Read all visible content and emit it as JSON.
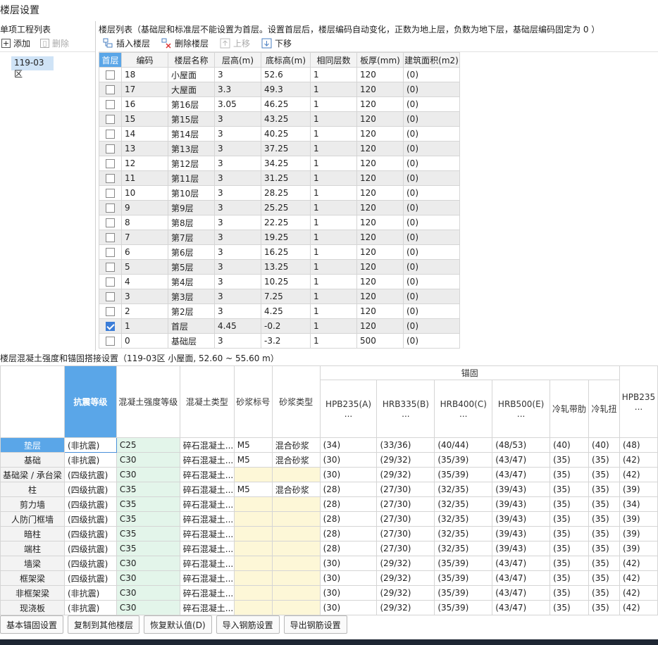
{
  "window": {
    "title": "楼层设置"
  },
  "left": {
    "header": "单项工程列表",
    "add": "添加",
    "delete": "删除",
    "items": [
      "119-03区"
    ]
  },
  "right": {
    "header": "楼层列表（基础层和标准层不能设置为首层。设置首层后，楼层编码自动变化，正数为地上层，负数为地下层，基础层编码固定为 0 ）",
    "insert": "插入楼层",
    "delete": "删除楼层",
    "up": "上移",
    "down": "下移",
    "columns": [
      "首层",
      "编码",
      "楼层名称",
      "层高(m)",
      "底标高(m)",
      "相同层数",
      "板厚(mm)",
      "建筑面积(m2)"
    ],
    "rows": [
      {
        "checked": false,
        "code": "18",
        "name": "小屋面",
        "height": "3",
        "elev": "52.6",
        "same": "1",
        "thick": "120",
        "area": "(0)"
      },
      {
        "checked": false,
        "code": "17",
        "name": "大屋面",
        "height": "3.3",
        "elev": "49.3",
        "same": "1",
        "thick": "120",
        "area": "(0)"
      },
      {
        "checked": false,
        "code": "16",
        "name": "第16层",
        "height": "3.05",
        "elev": "46.25",
        "same": "1",
        "thick": "120",
        "area": "(0)"
      },
      {
        "checked": false,
        "code": "15",
        "name": "第15层",
        "height": "3",
        "elev": "43.25",
        "same": "1",
        "thick": "120",
        "area": "(0)"
      },
      {
        "checked": false,
        "code": "14",
        "name": "第14层",
        "height": "3",
        "elev": "40.25",
        "same": "1",
        "thick": "120",
        "area": "(0)"
      },
      {
        "checked": false,
        "code": "13",
        "name": "第13层",
        "height": "3",
        "elev": "37.25",
        "same": "1",
        "thick": "120",
        "area": "(0)"
      },
      {
        "checked": false,
        "code": "12",
        "name": "第12层",
        "height": "3",
        "elev": "34.25",
        "same": "1",
        "thick": "120",
        "area": "(0)"
      },
      {
        "checked": false,
        "code": "11",
        "name": "第11层",
        "height": "3",
        "elev": "31.25",
        "same": "1",
        "thick": "120",
        "area": "(0)"
      },
      {
        "checked": false,
        "code": "10",
        "name": "第10层",
        "height": "3",
        "elev": "28.25",
        "same": "1",
        "thick": "120",
        "area": "(0)"
      },
      {
        "checked": false,
        "code": "9",
        "name": "第9层",
        "height": "3",
        "elev": "25.25",
        "same": "1",
        "thick": "120",
        "area": "(0)"
      },
      {
        "checked": false,
        "code": "8",
        "name": "第8层",
        "height": "3",
        "elev": "22.25",
        "same": "1",
        "thick": "120",
        "area": "(0)"
      },
      {
        "checked": false,
        "code": "7",
        "name": "第7层",
        "height": "3",
        "elev": "19.25",
        "same": "1",
        "thick": "120",
        "area": "(0)"
      },
      {
        "checked": false,
        "code": "6",
        "name": "第6层",
        "height": "3",
        "elev": "16.25",
        "same": "1",
        "thick": "120",
        "area": "(0)"
      },
      {
        "checked": false,
        "code": "5",
        "name": "第5层",
        "height": "3",
        "elev": "13.25",
        "same": "1",
        "thick": "120",
        "area": "(0)"
      },
      {
        "checked": false,
        "code": "4",
        "name": "第4层",
        "height": "3",
        "elev": "10.25",
        "same": "1",
        "thick": "120",
        "area": "(0)"
      },
      {
        "checked": false,
        "code": "3",
        "name": "第3层",
        "height": "3",
        "elev": "7.25",
        "same": "1",
        "thick": "120",
        "area": "(0)"
      },
      {
        "checked": false,
        "code": "2",
        "name": "第2层",
        "height": "3",
        "elev": "4.25",
        "same": "1",
        "thick": "120",
        "area": "(0)"
      },
      {
        "checked": true,
        "code": "1",
        "name": "首层",
        "height": "4.45",
        "elev": "-0.2",
        "same": "1",
        "thick": "120",
        "area": "(0)"
      },
      {
        "checked": false,
        "code": "0",
        "name": "基础层",
        "height": "3",
        "elev": "-3.2",
        "same": "1",
        "thick": "500",
        "area": "(0)"
      }
    ]
  },
  "anchor": {
    "title": "楼层混凝土强度和锚固搭接设置（119-03区 小屋面, 52.60 ~ 55.60 m）",
    "group_label": "锚固",
    "columns": [
      "抗震等级",
      "混凝土强度等级",
      "混凝土类型",
      "砂浆标号",
      "砂浆类型",
      "HPB235(A)\n...",
      "HRB335(B)\n...",
      "HRB400(C)\n...",
      "HRB500(E)\n...",
      "冷轧带肋",
      "冷轧扭",
      "HPB235\n..."
    ],
    "rows": [
      {
        "name": "垫层",
        "seis": "(非抗震)",
        "grade": "C25",
        "type": "碎石混凝土...",
        "mark": "M5",
        "mtype": "混合砂浆",
        "a": "(34)",
        "b": "(33/36)",
        "c": "(40/44)",
        "e": "(48/53)",
        "lr": "(40)",
        "lz": "(40)",
        "h2": "(48)"
      },
      {
        "name": "基础",
        "seis": "(非抗震)",
        "grade": "C30",
        "type": "碎石混凝土...",
        "mark": "M5",
        "mtype": "混合砂浆",
        "a": "(30)",
        "b": "(29/32)",
        "c": "(35/39)",
        "e": "(43/47)",
        "lr": "(35)",
        "lz": "(35)",
        "h2": "(42)"
      },
      {
        "name": "基础梁 / 承台梁",
        "seis": "(四级抗震)",
        "grade": "C30",
        "type": "碎石混凝土...",
        "mark": "",
        "mtype": "",
        "a": "(30)",
        "b": "(29/32)",
        "c": "(35/39)",
        "e": "(43/47)",
        "lr": "(35)",
        "lz": "(35)",
        "h2": "(42)"
      },
      {
        "name": "柱",
        "seis": "(四级抗震)",
        "grade": "C35",
        "type": "碎石混凝土...",
        "mark": "M5",
        "mtype": "混合砂浆",
        "a": "(28)",
        "b": "(27/30)",
        "c": "(32/35)",
        "e": "(39/43)",
        "lr": "(35)",
        "lz": "(35)",
        "h2": "(39)"
      },
      {
        "name": "剪力墙",
        "seis": "(四级抗震)",
        "grade": "C35",
        "type": "碎石混凝土...",
        "mark": "",
        "mtype": "",
        "a": "(28)",
        "b": "(27/30)",
        "c": "(32/35)",
        "e": "(39/43)",
        "lr": "(35)",
        "lz": "(35)",
        "h2": "(34)"
      },
      {
        "name": "人防门框墙",
        "seis": "(四级抗震)",
        "grade": "C35",
        "type": "碎石混凝土...",
        "mark": "",
        "mtype": "",
        "a": "(28)",
        "b": "(27/30)",
        "c": "(32/35)",
        "e": "(39/43)",
        "lr": "(35)",
        "lz": "(35)",
        "h2": "(39)"
      },
      {
        "name": "暗柱",
        "seis": "(四级抗震)",
        "grade": "C35",
        "type": "碎石混凝土...",
        "mark": "",
        "mtype": "",
        "a": "(28)",
        "b": "(27/30)",
        "c": "(32/35)",
        "e": "(39/43)",
        "lr": "(35)",
        "lz": "(35)",
        "h2": "(39)"
      },
      {
        "name": "端柱",
        "seis": "(四级抗震)",
        "grade": "C35",
        "type": "碎石混凝土...",
        "mark": "",
        "mtype": "",
        "a": "(28)",
        "b": "(27/30)",
        "c": "(32/35)",
        "e": "(39/43)",
        "lr": "(35)",
        "lz": "(35)",
        "h2": "(39)"
      },
      {
        "name": "墙梁",
        "seis": "(四级抗震)",
        "grade": "C30",
        "type": "碎石混凝土...",
        "mark": "",
        "mtype": "",
        "a": "(30)",
        "b": "(29/32)",
        "c": "(35/39)",
        "e": "(43/47)",
        "lr": "(35)",
        "lz": "(35)",
        "h2": "(42)"
      },
      {
        "name": "框架梁",
        "seis": "(四级抗震)",
        "grade": "C30",
        "type": "碎石混凝土...",
        "mark": "",
        "mtype": "",
        "a": "(30)",
        "b": "(29/32)",
        "c": "(35/39)",
        "e": "(43/47)",
        "lr": "(35)",
        "lz": "(35)",
        "h2": "(42)"
      },
      {
        "name": "非框架梁",
        "seis": "(非抗震)",
        "grade": "C30",
        "type": "碎石混凝土...",
        "mark": "",
        "mtype": "",
        "a": "(30)",
        "b": "(29/32)",
        "c": "(35/39)",
        "e": "(43/47)",
        "lr": "(35)",
        "lz": "(35)",
        "h2": "(42)"
      },
      {
        "name": "现浇板",
        "seis": "(非抗震)",
        "grade": "C30",
        "type": "碎石混凝土...",
        "mark": "",
        "mtype": "",
        "a": "(30)",
        "b": "(29/32)",
        "c": "(35/39)",
        "e": "(43/47)",
        "lr": "(35)",
        "lz": "(35)",
        "h2": "(42)"
      }
    ]
  },
  "footer": {
    "buttons": [
      "基本锚固设置",
      "复制到其他楼层",
      "恢复默认值(D)",
      "导入钢筋设置",
      "导出钢筋设置"
    ]
  },
  "colors": {
    "accent": "#5aa6e8",
    "selection": "#cfe3f6",
    "green_cell": "#e3f5ea",
    "yellow_cell": "#fdf7d7"
  }
}
